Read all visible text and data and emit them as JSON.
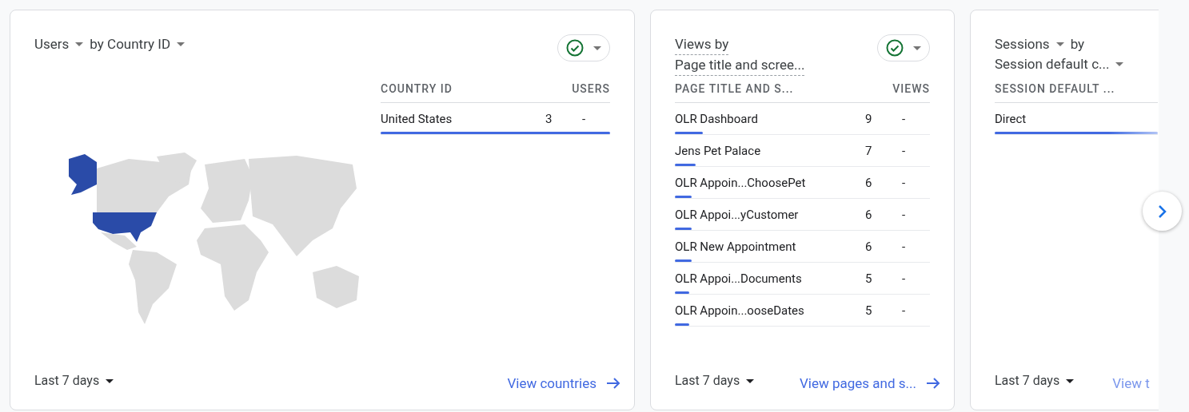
{
  "cards": [
    {
      "title_parts": [
        {
          "text": "Users",
          "caret": true
        },
        {
          "text": "by Country ID",
          "caret": true
        }
      ],
      "title_underlined": false,
      "comparison": true,
      "map": true,
      "columns": [
        "COUNTRY ID",
        "USERS"
      ],
      "rows": [
        {
          "label": "United States",
          "value": "3",
          "change": "-",
          "level": 1
        }
      ],
      "date_range": "Last 7 days",
      "link": "View countries",
      "link_arrow": true
    },
    {
      "title_parts": [
        {
          "text": "Views by",
          "caret": false
        },
        {
          "text": "Page title and scree...",
          "caret": false
        }
      ],
      "title_underlined": true,
      "comparison": true,
      "map": false,
      "columns": [
        "PAGE TITLE AND S...",
        "VIEWS"
      ],
      "rows": [
        {
          "label": "OLR Dashboard",
          "value": "9",
          "change": "-",
          "level": 0.11
        },
        {
          "label": "Jens Pet Palace",
          "value": "7",
          "change": "-",
          "level": 0.08
        },
        {
          "label": "OLR Appoin...ChoosePet",
          "value": "6",
          "change": "-",
          "level": 0.065
        },
        {
          "label": "OLR Appoi...yCustomer",
          "value": "6",
          "change": "-",
          "level": 0.065
        },
        {
          "label": "OLR New Appointment",
          "value": "6",
          "change": "-",
          "level": 0.065
        },
        {
          "label": "OLR Appoi...Documents",
          "value": "5",
          "change": "-",
          "level": 0.055
        },
        {
          "label": "OLR Appoin...ooseDates",
          "value": "5",
          "change": "-",
          "level": 0.055
        }
      ],
      "date_range": "Last 7 days",
      "link": "View pages and s...",
      "link_arrow": true
    },
    {
      "title_parts": [
        {
          "text": "Sessions",
          "caret": true
        },
        {
          "text": "by",
          "caret": false
        },
        {
          "text": "Session default c...",
          "caret": true
        }
      ],
      "title_underlined": false,
      "comparison": false,
      "map": false,
      "columns": [
        "SESSION DEFAULT ..."
      ],
      "rows": [
        {
          "label": "Direct",
          "level": 1
        }
      ],
      "date_range": "Last 7 days",
      "link": "View t",
      "link_arrow": false
    }
  ]
}
